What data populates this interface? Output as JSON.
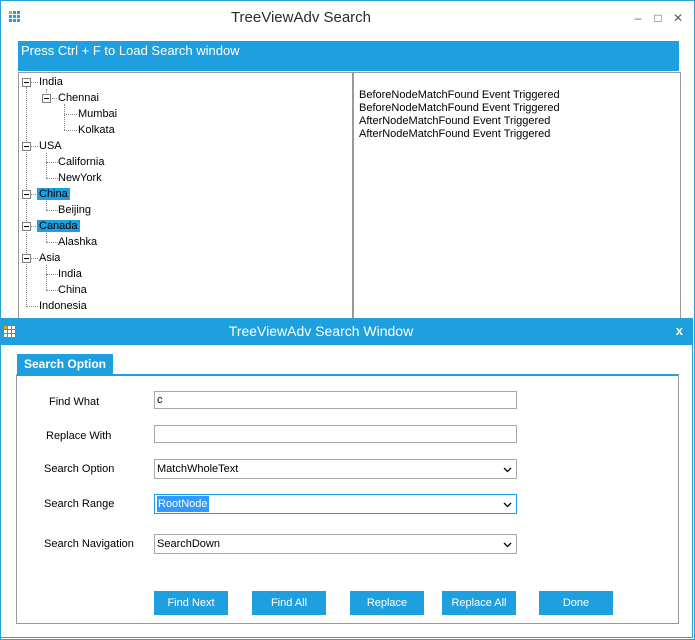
{
  "window": {
    "title": "TreeViewAdv Search",
    "minimize_glyph": "–",
    "maximize_glyph": "□",
    "close_glyph": "✕"
  },
  "banner": {
    "text": "Press Ctrl + F to Load Search window"
  },
  "tree": {
    "nodes": [
      {
        "label": "India"
      },
      {
        "label": "Chennai"
      },
      {
        "label": "Mumbai"
      },
      {
        "label": "Kolkata"
      },
      {
        "label": "USA"
      },
      {
        "label": "California"
      },
      {
        "label": "NewYork"
      },
      {
        "label": "China",
        "selected": true
      },
      {
        "label": "Beijing"
      },
      {
        "label": "Canada",
        "selected": true
      },
      {
        "label": "Alashka"
      },
      {
        "label": "Asia"
      },
      {
        "label": "India"
      },
      {
        "label": "China"
      },
      {
        "label": "Indonesia"
      }
    ]
  },
  "log": {
    "lines": [
      "BeforeNodeMatchFound Event Triggered",
      "BeforeNodeMatchFound Event Triggered",
      "AfterNodeMatchFound Event Triggered",
      "AfterNodeMatchFound Event Triggered"
    ]
  },
  "dialog": {
    "title": "TreeViewAdv Search Window",
    "close_glyph": "x",
    "tab_label": "Search Option",
    "find_what": {
      "label": "Find What",
      "value": "c"
    },
    "replace_with": {
      "label": "Replace With",
      "value": ""
    },
    "search_option": {
      "label": "Search Option",
      "value": "MatchWholeText"
    },
    "search_range": {
      "label": "Search Range",
      "value": "RootNode"
    },
    "search_navigation": {
      "label": "Search Navigation",
      "value": "SearchDown"
    },
    "buttons": {
      "find_next": "Find Next",
      "find_all": "Find All",
      "replace": "Replace",
      "replace_all": "Replace All",
      "done": "Done"
    }
  },
  "colors": {
    "accent": "#1ea0e0",
    "selection": "#3399ff"
  }
}
